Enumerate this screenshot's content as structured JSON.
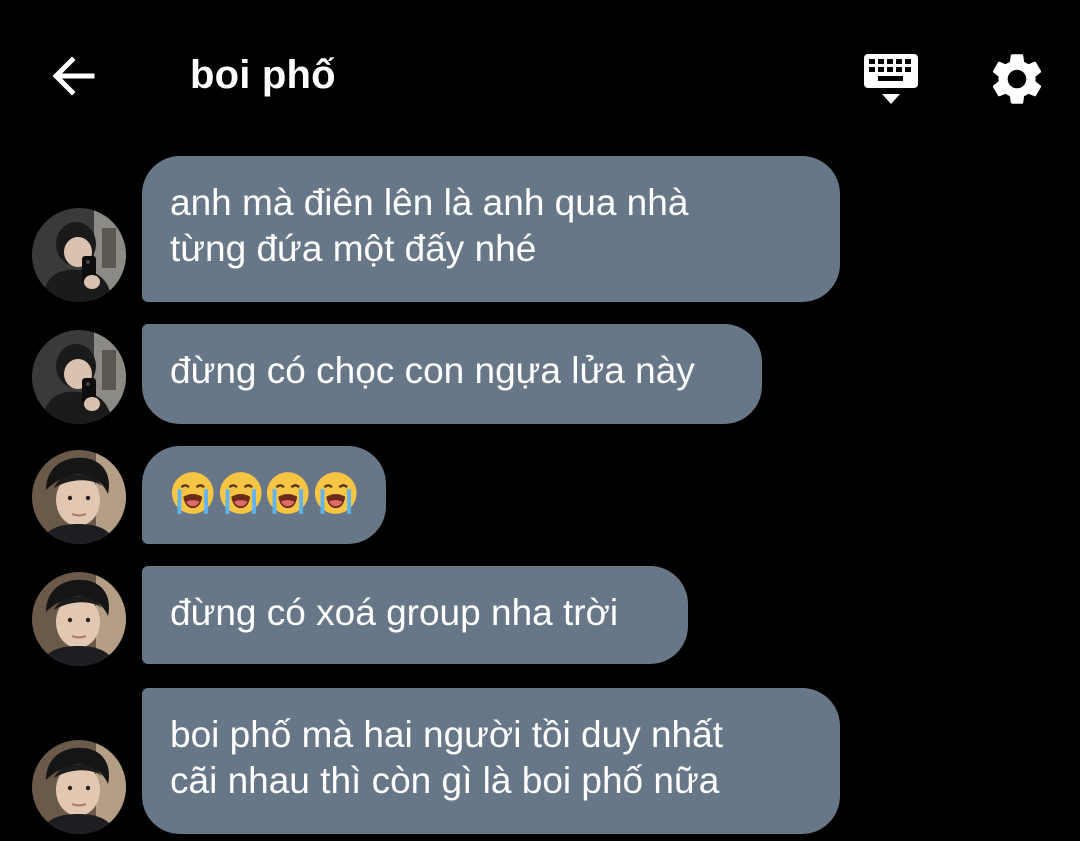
{
  "header": {
    "back_icon": "arrow-left-icon",
    "title": "boi phố",
    "keyboard_icon": "keyboard-icon",
    "settings_icon": "gear-icon"
  },
  "messages": [
    {
      "sender_avatar": "avatar-mirror-selfie",
      "lines": [
        "anh mà điên lên là anh qua nhà",
        "từng đứa một đấy nhé"
      ]
    },
    {
      "sender_avatar": "avatar-mirror-selfie",
      "lines": [
        "đừng có chọc con ngựa lửa này"
      ]
    },
    {
      "sender_avatar": "avatar-portrait",
      "emojis": [
        "😭",
        "😭",
        "😭",
        "😭"
      ],
      "emoji_icon": "loudly-crying-face-icon"
    },
    {
      "sender_avatar": "avatar-portrait",
      "lines": [
        "đừng có xoá group nha trời"
      ]
    },
    {
      "sender_avatar": "avatar-portrait",
      "lines": [
        "boi phố mà hai người tồi duy nhất",
        "cãi nhau thì còn gì là boi phố nữa"
      ]
    }
  ],
  "colors": {
    "background": "#000000",
    "bubble": "#677787",
    "text": "#ffffff"
  }
}
